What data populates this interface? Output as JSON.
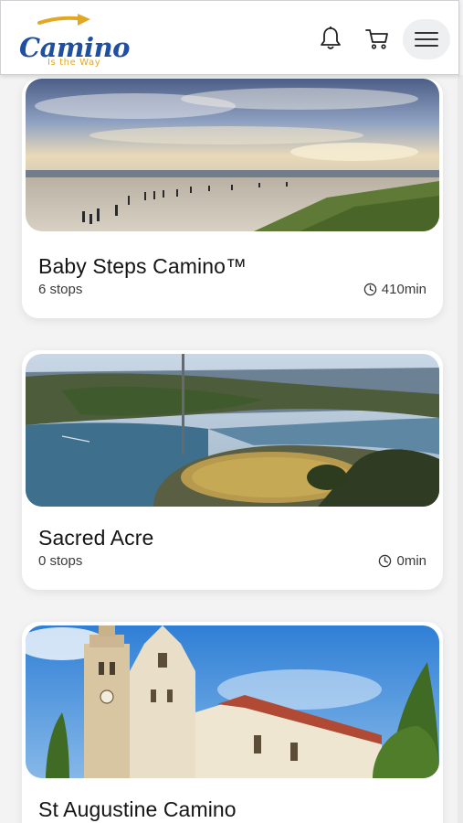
{
  "header": {
    "logo_word": "Camino",
    "logo_tagline": "Is the Way",
    "icons": [
      "bell-icon",
      "cart-icon",
      "hamburger-menu-icon"
    ]
  },
  "colors": {
    "brand_blue": "#1f4fa0",
    "brand_gold": "#e3a823",
    "card_bg": "#ffffff",
    "page_bg": "#f3f3f4"
  },
  "cards": [
    {
      "title": "Baby Steps Camino™",
      "stops": "6 stops",
      "duration": "410min",
      "image": "beach-walkers-photo"
    },
    {
      "title": "Sacred Acre",
      "stops": "0 stops",
      "duration": "0min",
      "image": "aerial-shrine-photo"
    },
    {
      "title": "St Augustine Camino",
      "stops": "",
      "duration": "",
      "image": "cathedral-photo"
    }
  ]
}
